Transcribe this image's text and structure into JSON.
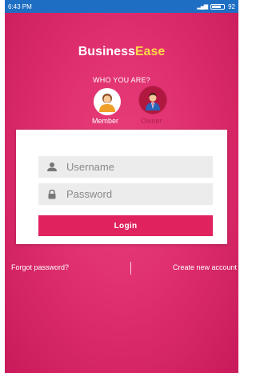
{
  "status_bar": {
    "time": "6:43 PM",
    "battery": "92"
  },
  "app": {
    "title_part1": "Business",
    "title_part2": "Ease",
    "title_part2_color": "#ffd84a"
  },
  "role_selector": {
    "prompt": "WHO YOU ARE?",
    "options": [
      {
        "label": "Member",
        "icon": "member-avatar-icon",
        "selected": true
      },
      {
        "label": "Owner",
        "icon": "owner-avatar-icon",
        "selected": false
      }
    ]
  },
  "login_form": {
    "username_placeholder": "Username",
    "password_placeholder": "Password",
    "login_label": "Login"
  },
  "links": {
    "forgot_password": "Forgot password?",
    "create_account": "Create new account"
  },
  "colors": {
    "accent": "#e0235e",
    "status_bar": "#1e6fc4"
  }
}
